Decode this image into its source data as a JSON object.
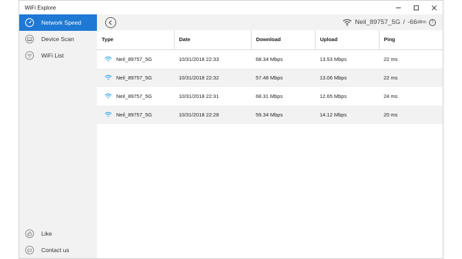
{
  "window": {
    "title": "WiFi Explore"
  },
  "sidebar": {
    "items": [
      {
        "label": "Network Speed",
        "icon": "speedometer-icon",
        "active": true
      },
      {
        "label": "Device Scan",
        "icon": "device-scan-icon",
        "active": false
      },
      {
        "label": "WiFi List",
        "icon": "wifi-list-icon",
        "active": false
      }
    ],
    "bottom_items": [
      {
        "label": "Like",
        "icon": "thumbs-up-icon"
      },
      {
        "label": "Contact us",
        "icon": "contact-icon"
      }
    ]
  },
  "header": {
    "network_name": "Neil_89757_5G",
    "separator": "/",
    "signal_value": "-66",
    "signal_unit": "dBm",
    "info_symbol": "!"
  },
  "table": {
    "columns": [
      "Type",
      "Date",
      "Download",
      "Upload",
      "Ping"
    ],
    "rows": [
      {
        "type": "Neil_89757_5G",
        "date": "10/31/2018 22:33",
        "download": "68.34 Mbps",
        "upload": "13.53 Mbps",
        "ping": "22 ms"
      },
      {
        "type": "Neil_89757_5G",
        "date": "10/31/2018 22:32",
        "download": "57.48 Mbps",
        "upload": "13.06 Mbps",
        "ping": "22 ms"
      },
      {
        "type": "Neil_89757_5G",
        "date": "10/31/2018 22:31",
        "download": "68.31 Mbps",
        "upload": "12.65 Mbps",
        "ping": "24 ms"
      },
      {
        "type": "Neil_89757_5G",
        "date": "10/31/2018 22:28",
        "download": "59.34 Mbps",
        "upload": "14.12 Mbps",
        "ping": "20 ms"
      }
    ]
  },
  "colors": {
    "accent": "#1e79d4",
    "wifi": "#29a3e6",
    "sidebar_bg": "#f2f2f2"
  }
}
